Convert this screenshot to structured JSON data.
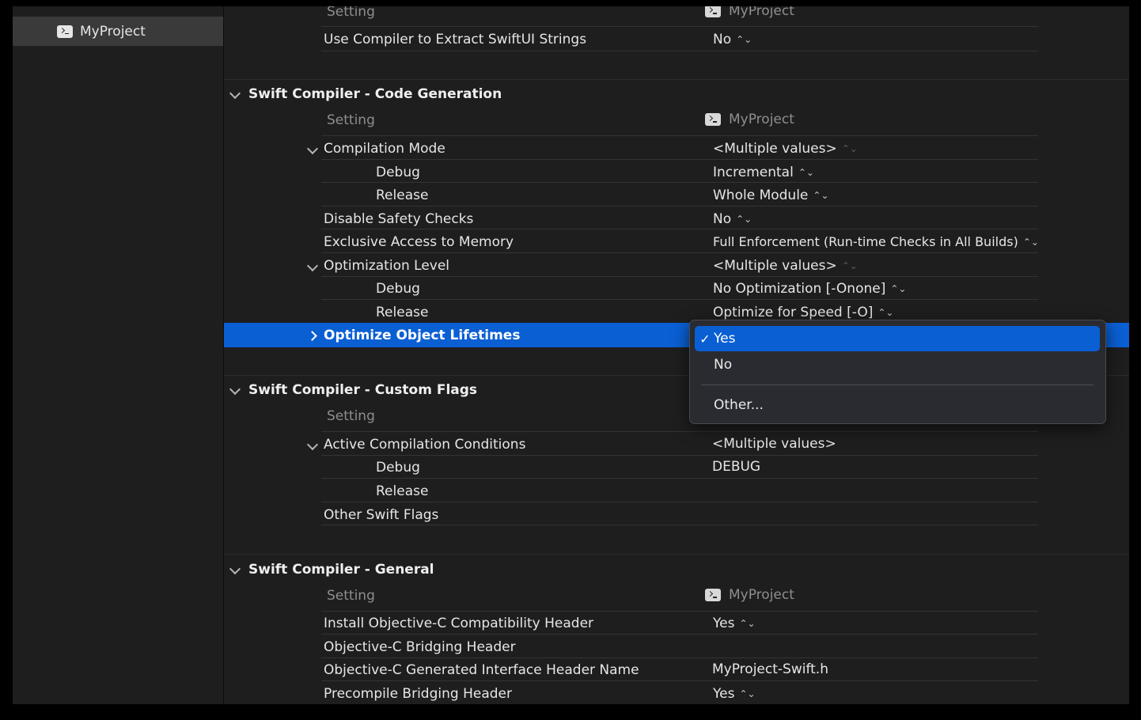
{
  "sidebar": {
    "project_name": "MyProject"
  },
  "top_section": {
    "setting_label": "Setting",
    "project_col": "MyProject",
    "rows": [
      {
        "name": "Use Compiler to Extract SwiftUI Strings",
        "value": "No"
      }
    ]
  },
  "code_gen": {
    "title": "Swift Compiler - Code Generation",
    "setting_label": "Setting",
    "project_col": "MyProject",
    "compilation_mode": {
      "name": "Compilation Mode",
      "value": "<Multiple values>",
      "debug_label": "Debug",
      "debug_value": "Incremental",
      "release_label": "Release",
      "release_value": "Whole Module"
    },
    "disable_safety": {
      "name": "Disable Safety Checks",
      "value": "No"
    },
    "exclusive_access": {
      "name": "Exclusive Access to Memory",
      "value": "Full Enforcement (Run-time Checks in All Builds)"
    },
    "optimization_level": {
      "name": "Optimization Level",
      "value": "<Multiple values>",
      "debug_label": "Debug",
      "debug_value": "No Optimization [-Onone]",
      "release_label": "Release",
      "release_value": "Optimize for Speed [-O]"
    },
    "object_lifetimes": {
      "name": "Optimize Object Lifetimes"
    }
  },
  "custom_flags": {
    "title": "Swift Compiler - Custom Flags",
    "setting_label": "Setting",
    "active_conditions": {
      "name": "Active Compilation Conditions",
      "value": "<Multiple values>",
      "debug_label": "Debug",
      "debug_value": "DEBUG",
      "release_label": "Release"
    },
    "other_flags": {
      "name": "Other Swift Flags"
    }
  },
  "general": {
    "title": "Swift Compiler - General",
    "setting_label": "Setting",
    "project_col": "MyProject",
    "install_header": {
      "name": "Install Objective-C Compatibility Header",
      "value": "Yes"
    },
    "bridging_header": {
      "name": "Objective-C Bridging Header"
    },
    "generated_header": {
      "name": "Objective-C Generated Interface Header Name",
      "value": "MyProject-Swift.h"
    },
    "precompile": {
      "name": "Precompile Bridging Header",
      "value": "Yes"
    }
  },
  "popup_menu": {
    "items": [
      {
        "label": "Yes",
        "check": "✓"
      },
      {
        "label": "No"
      },
      {
        "label": "Other..."
      }
    ]
  }
}
